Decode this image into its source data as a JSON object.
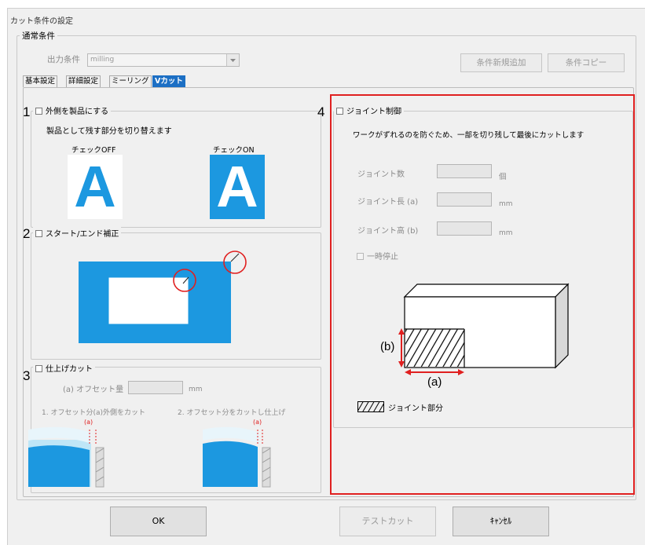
{
  "window": {
    "title": "カット条件の設定"
  },
  "normal_conditions": {
    "legend": "通常条件",
    "output_label": "出力条件",
    "output_value": "milling",
    "add_button": "条件新規追加",
    "copy_button": "条件コピー"
  },
  "tabs": [
    "基本設定",
    "詳細設定",
    "ミーリング",
    "Vカット"
  ],
  "sections": {
    "s1": {
      "number": "1",
      "checkbox_label": "外側を製品にする",
      "description": "製品として残す部分を切り替えます",
      "off_label": "チェックOFF",
      "on_label": "チェックON",
      "sample_letter": "A"
    },
    "s2": {
      "number": "2",
      "checkbox_label": "スタート/エンド補正"
    },
    "s3": {
      "number": "3",
      "checkbox_label": "仕上げカット",
      "offset_label": "(a) オフセット量",
      "unit": "mm",
      "caption1": "1. オフセット分(a)外側をカット",
      "caption2": "2. オフセット分をカットし仕上げ",
      "marker": "(a)"
    },
    "s4": {
      "number": "4",
      "checkbox_label": "ジョイント制御",
      "description": "ワークがずれるのを防ぐため、一部を切り残して最後にカットします",
      "count_label": "ジョイント数",
      "count_unit": "個",
      "length_label": "ジョイント長 (a)",
      "length_unit": "mm",
      "height_label": "ジョイント高 (b)",
      "height_unit": "mm",
      "pause_label": "一時停止",
      "dim_b": "(b)",
      "dim_a": "(a)",
      "legend_label": "ジョイント部分"
    }
  },
  "footer": {
    "ok": "OK",
    "test_cut": "テストカット",
    "cancel": "ｷｬﾝｾﾙ"
  },
  "colors": {
    "accent": "#1c98e0",
    "highlight_red": "#e02020"
  }
}
